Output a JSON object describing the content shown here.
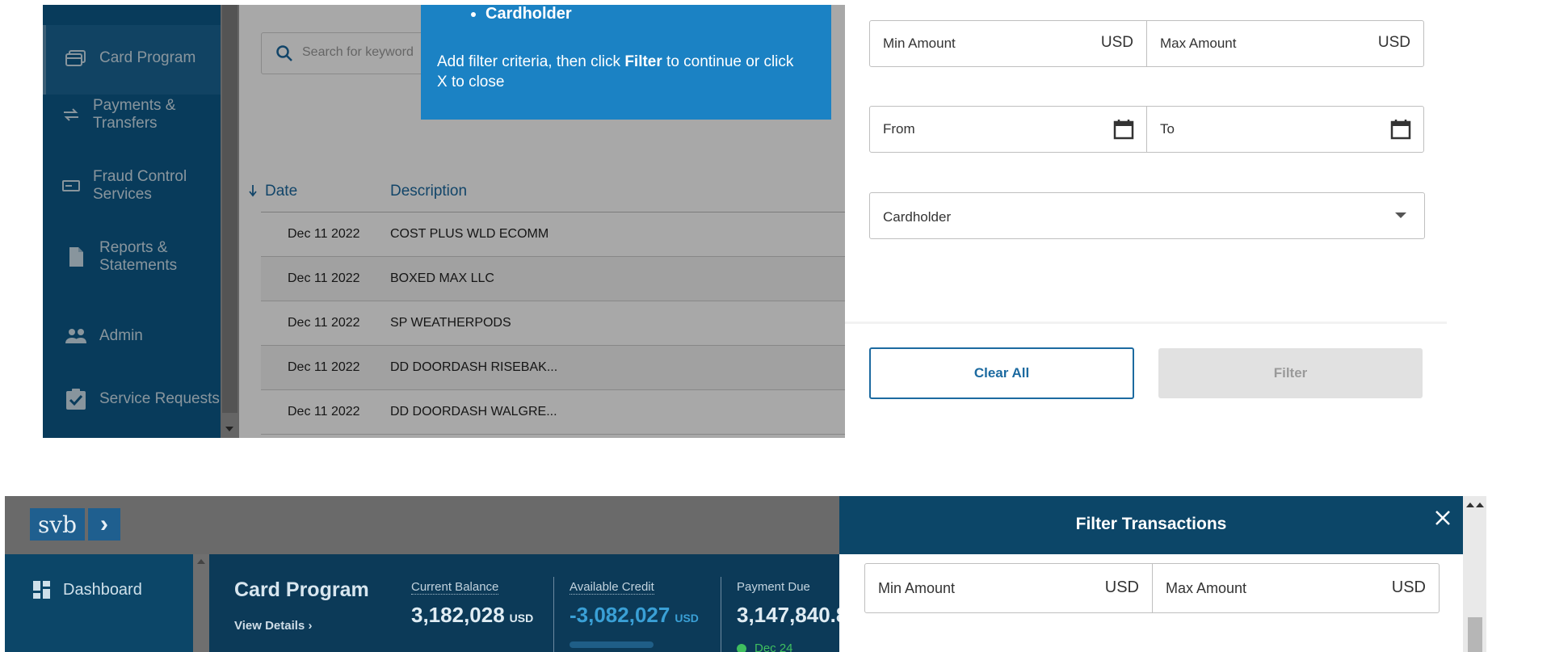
{
  "top_left": {
    "sidebar": {
      "items": [
        {
          "label": "Card Program",
          "icon": "card-icon",
          "active": true
        },
        {
          "label": "Payments & Transfers",
          "icon": "transfer-icon"
        },
        {
          "label": "Fraud Control Services",
          "icon": "card-outline-icon"
        },
        {
          "label": "Reports & Statements",
          "icon": "document-icon"
        },
        {
          "label": "Admin",
          "icon": "people-icon"
        },
        {
          "label": "Service Requests",
          "icon": "clipboard-check-icon"
        }
      ]
    },
    "search": {
      "placeholder": "Search for keyword"
    },
    "table": {
      "headers": {
        "date": "Date",
        "description": "Description"
      },
      "rows": [
        {
          "date": "Dec 11 2022",
          "description": "COST PLUS WLD ECOMM"
        },
        {
          "date": "Dec 11 2022",
          "description": "BOXED MAX LLC"
        },
        {
          "date": "Dec 11 2022",
          "description": "SP WEATHERPODS"
        },
        {
          "date": "Dec 11 2022",
          "description": "DD DOORDASH RISEBAK..."
        },
        {
          "date": "Dec 11 2022",
          "description": "DD DOORDASH WALGRE..."
        }
      ]
    },
    "tooltip": {
      "bullet": "Cardholder",
      "msg_part1": "Add filter criteria, then click ",
      "msg_bold": "Filter",
      "msg_part2": " to continue or click X to close"
    }
  },
  "top_right": {
    "min_amount": {
      "label": "Min Amount",
      "unit": "USD"
    },
    "max_amount": {
      "label": "Max Amount",
      "unit": "USD"
    },
    "from": {
      "label": "From"
    },
    "to": {
      "label": "To"
    },
    "cardholder": {
      "label": "Cardholder"
    },
    "clear_all": "Clear All",
    "filter": "Filter"
  },
  "bottom": {
    "logo": {
      "text": "svb",
      "chevron": "›"
    },
    "sidebar": {
      "dashboard": "Dashboard"
    },
    "summary": {
      "title": "Card Program",
      "view_details": "View Details",
      "current_balance": {
        "label": "Current Balance",
        "value": "3,182,028",
        "unit": "USD"
      },
      "available_credit": {
        "label": "Available Credit",
        "value": "-3,082,027",
        "unit": "USD"
      },
      "payment_due": {
        "label": "Payment Due",
        "value": "3,147,840.8",
        "date": "Dec 24"
      }
    },
    "drawer": {
      "title": "Filter Transactions",
      "min_amount": {
        "label": "Min Amount",
        "unit": "USD"
      },
      "max_amount": {
        "label": "Max Amount",
        "unit": "USD"
      }
    }
  },
  "colors": {
    "brand_blue": "#0c4668",
    "accent_blue": "#1c6aa0",
    "tooltip_blue": "#1b82c4",
    "due_green": "#3fbf5f"
  }
}
